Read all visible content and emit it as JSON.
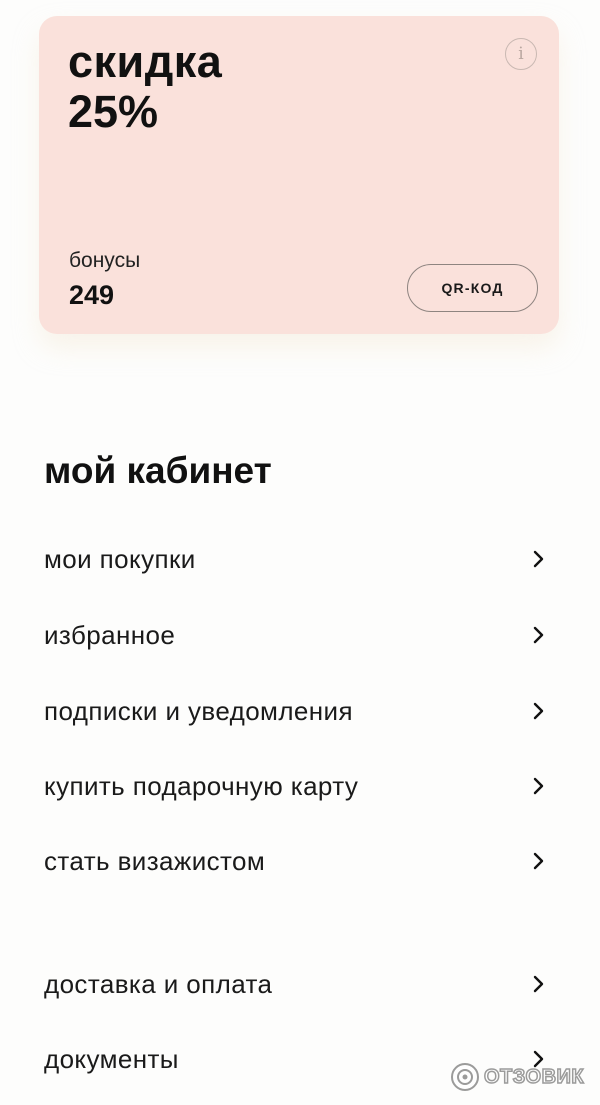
{
  "card": {
    "discount_title": "скидка",
    "discount_value": "25%",
    "info_icon": "info-icon",
    "bonus_label": "бонусы",
    "bonus_value": "249",
    "qr_button_label": "QR-КОД",
    "background_color": "#fae1db"
  },
  "account": {
    "title": "мой кабинет",
    "items": [
      {
        "label": "мои покупки",
        "icon": "chevron-right-icon"
      },
      {
        "label": "избранное",
        "icon": "chevron-right-icon"
      },
      {
        "label": "подписки и уведомления",
        "icon": "chevron-right-icon"
      },
      {
        "label": "купить подарочную карту",
        "icon": "chevron-right-icon"
      },
      {
        "label": "стать визажистом",
        "icon": "chevron-right-icon"
      }
    ],
    "info_items": [
      {
        "label": "доставка и оплата",
        "icon": "chevron-right-icon"
      },
      {
        "label": "документы",
        "icon": "chevron-right-icon"
      }
    ]
  },
  "watermark": {
    "text": "ОТЗОВИК"
  }
}
